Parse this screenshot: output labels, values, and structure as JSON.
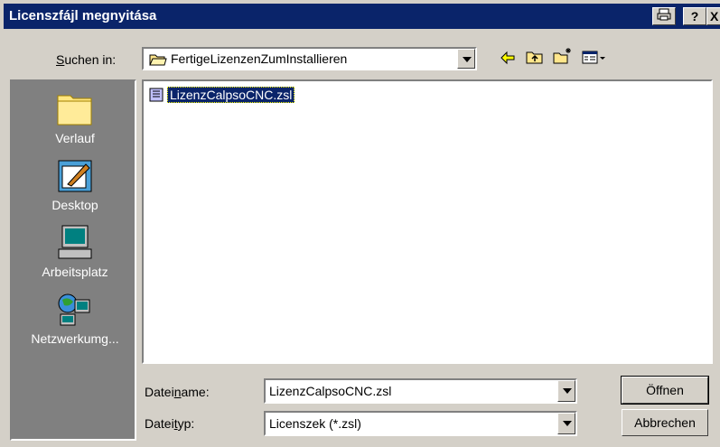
{
  "window": {
    "title": "Licenszfájl megnyitása"
  },
  "titlebar": {
    "print_icon": "printer-icon",
    "help_label": "?",
    "close_label": "X"
  },
  "lookin": {
    "label": "Suchen in:",
    "value": "FertigeLizenzenZumInstallieren"
  },
  "toolbar": {
    "icons": [
      "back-arrow-icon",
      "up-folder-icon",
      "new-folder-icon",
      "view-menu-icon"
    ]
  },
  "places": [
    {
      "label": "Verlauf",
      "icon": "history-folder-icon"
    },
    {
      "label": "Desktop",
      "icon": "desktop-icon"
    },
    {
      "label": "Arbeitsplatz",
      "icon": "my-computer-icon"
    },
    {
      "label": "Netzwerkumg...",
      "icon": "network-icon"
    }
  ],
  "files": [
    {
      "name": "LizenzCalpsoCNC.zsl",
      "selected": true
    }
  ],
  "filename": {
    "label": "Dateiname:",
    "value": "LizenzCalpsoCNC.zsl"
  },
  "filetype": {
    "label": "Dateityp:",
    "value": "Licenszek (*.zsl)"
  },
  "buttons": {
    "open": "Öffnen",
    "cancel": "Abbrechen"
  },
  "colors": {
    "titlebar": "#0a246a",
    "face": "#d4d0c8",
    "places_bg": "#808080",
    "selection": "#0a246a"
  }
}
